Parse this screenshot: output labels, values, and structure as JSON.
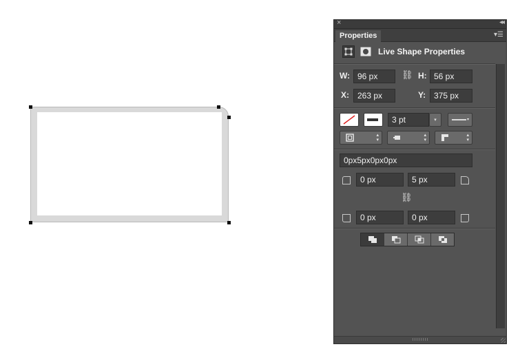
{
  "panel": {
    "tab_label": "Properties",
    "header_title": "Live Shape Properties",
    "icons": {
      "close": "close-icon",
      "collapse": "collapse-double-arrow-icon",
      "menu": "panel-menu-icon",
      "shape_mode": "bounding-box-icon",
      "mask_mode": "mask-icon"
    },
    "dimensions": {
      "w_label": "W:",
      "w_value": "96 px",
      "h_label": "H:",
      "h_value": "56 px",
      "x_label": "X:",
      "x_value": "263 px",
      "y_label": "Y:",
      "y_value": "375 px"
    },
    "stroke": {
      "width_value": "3 pt",
      "fill_state": "none",
      "stroke_color": "#ffffff"
    },
    "corners": {
      "summary_value": "0px5px0px0px",
      "top_left": "0 px",
      "top_right": "5 px",
      "bottom_left": "0 px",
      "bottom_right": "0 px"
    },
    "pathfinder": {
      "buttons": [
        "combine-shapes-icon",
        "subtract-front-shape-icon",
        "intersect-shape-areas-icon",
        "exclude-overlapping-shapes-icon"
      ]
    }
  },
  "colors": {
    "panel_bg": "#535353",
    "field_bg": "#3d3d3d",
    "shape_stroke": "#d9d9d9",
    "shape_fill": "#ffffff"
  }
}
